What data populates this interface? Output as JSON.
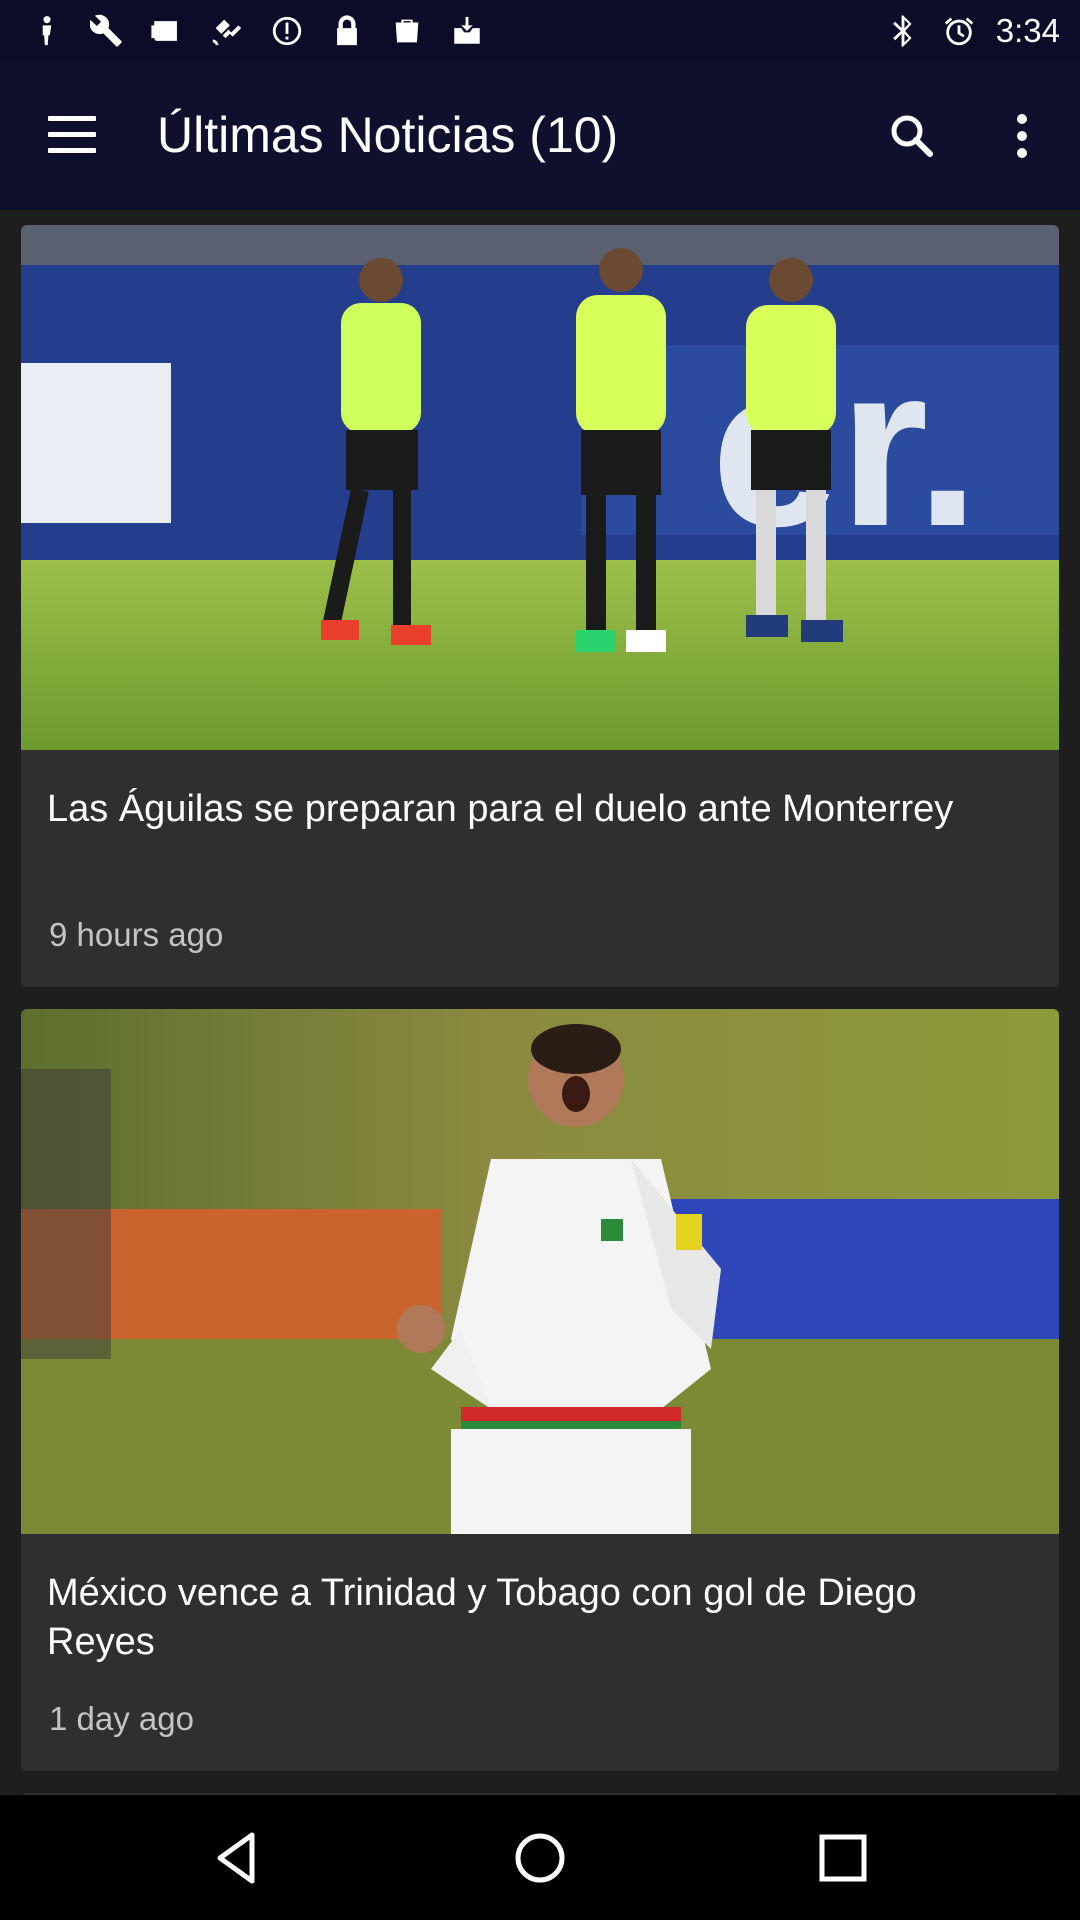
{
  "status_bar": {
    "time": "3:34",
    "left_icons": [
      "person-icon",
      "wrench-icon",
      "newspaper-icon",
      "satellite-icon",
      "data-saver-icon",
      "lock-icon",
      "bag-icon",
      "inbox-icon"
    ],
    "right_icons": [
      "bluetooth-icon",
      "alarm-icon"
    ]
  },
  "app_bar": {
    "title": "Últimas Noticias (10)",
    "menu_icon": "hamburger-menu-icon",
    "search_icon": "search-icon",
    "more_icon": "more-vert-icon"
  },
  "articles": [
    {
      "title": "Las Águilas se preparan para el duelo ante Monterrey",
      "time": "9 hours ago"
    },
    {
      "title": "México vence a Trinidad y Tobago con gol de Diego Reyes",
      "time": "1 day ago"
    }
  ],
  "nav_bar": {
    "back_icon": "back-icon",
    "home_icon": "home-icon",
    "recents_icon": "recents-icon"
  },
  "colors": {
    "status_bar_bg": "#0c0c28",
    "app_bar_bg": "#0f0f2e",
    "feed_bg": "#1e1e1e",
    "card_bg": "#2f2f2f",
    "title_text": "#ffffff",
    "time_text": "#c4c4c4"
  }
}
